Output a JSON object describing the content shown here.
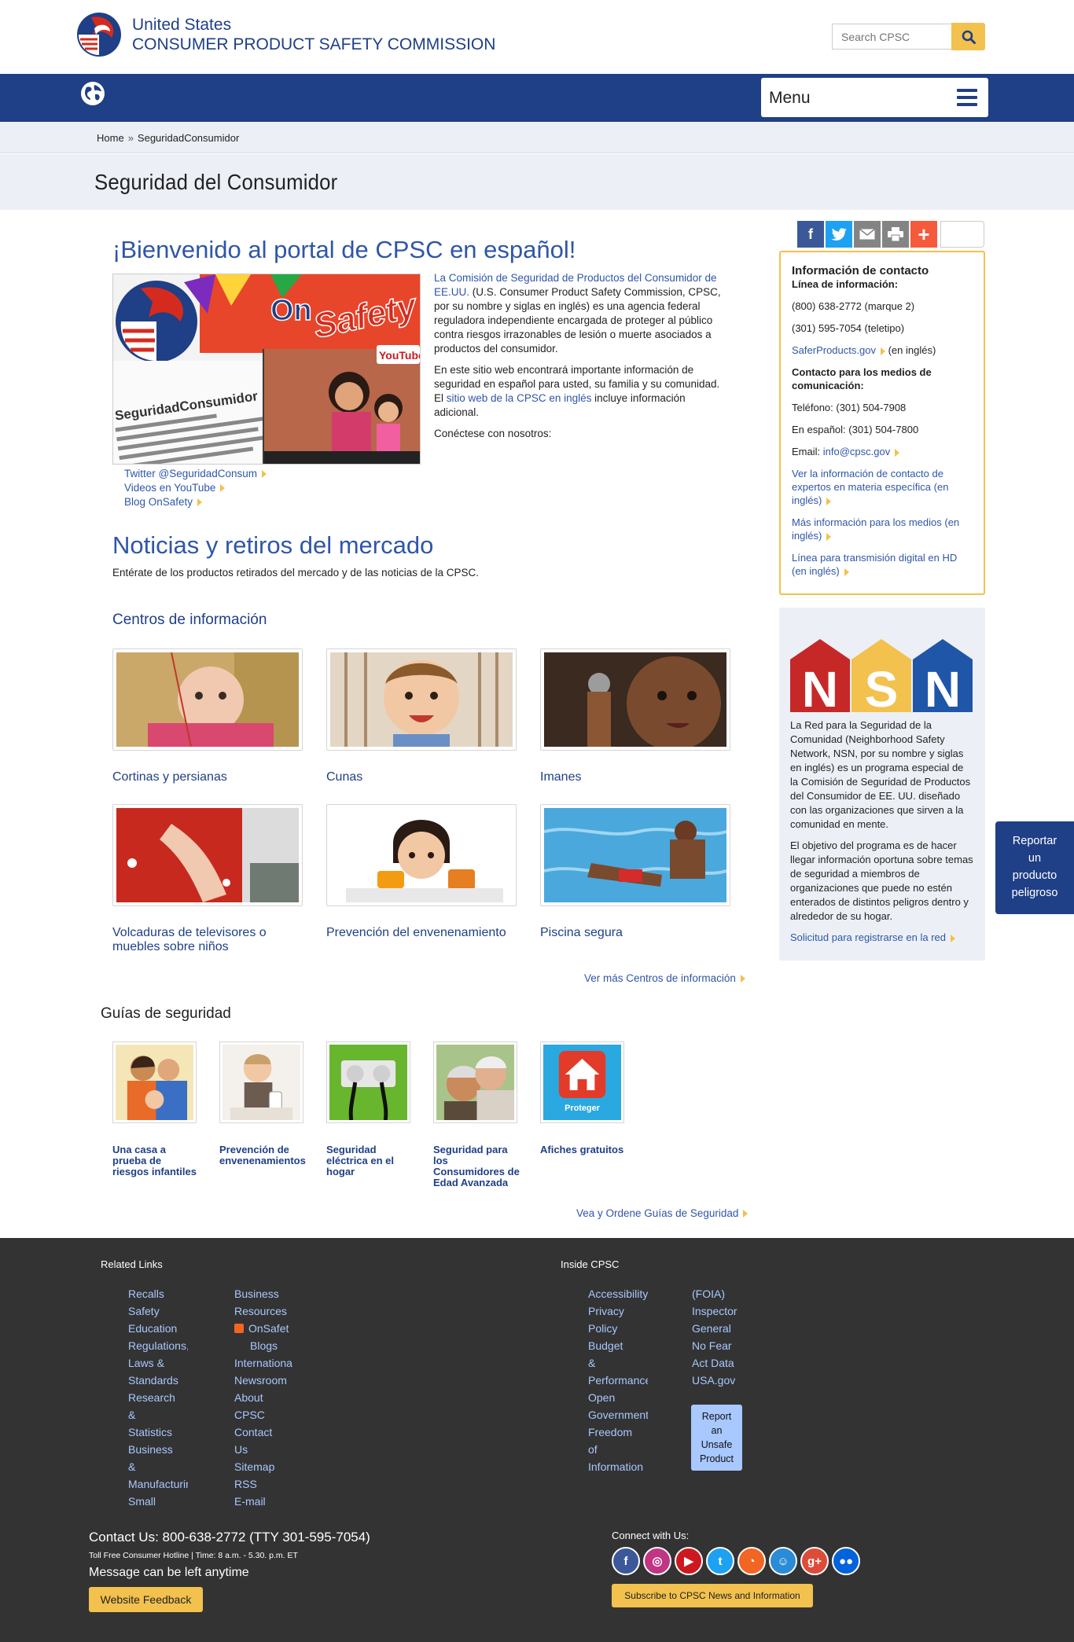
{
  "header": {
    "org_line1": "United States",
    "org_line2": "CONSUMER PRODUCT SAFETY COMMISSION",
    "search_placeholder": "Search CPSC"
  },
  "nav": {
    "menu_label": "Menu"
  },
  "breadcrumb": {
    "home": "Home",
    "sep": "»",
    "current": "SeguridadConsumidor"
  },
  "page_title": "Seguridad del Consumidor",
  "share": {
    "count": ""
  },
  "welcome": {
    "heading": "¡Bienvenido al portal de CPSC en español!",
    "para1_link": "La Comisión de Seguridad de Productos del Consumidor de EE.UU.",
    "para1_rest": " (U.S. Consumer Product Safety Commission, CPSC, por su nombre y siglas en inglés) es una agencia federal reguladora independiente encargada de proteger al público contra riesgos irrazonables de lesión o muerte asociados a productos del consumidor.",
    "para2_start": "En este sitio web encontrará importante información de seguridad en español para usted, su familia y su comunidad. El ",
    "para2_link": "sitio web de la CPSC en inglés",
    "para2_end": " incluye información adicional.",
    "para3": "Conéctese con nosotros:",
    "links": [
      "Twitter @SeguridadConsum",
      "Videos en YouTube",
      "Blog OnSafety"
    ],
    "image_text": {
      "on": "On",
      "safety": "Safety",
      "handle": "SeguridadConsumidor",
      "youtube": "YouTube"
    }
  },
  "news": {
    "heading": "Noticias y retiros del mercado",
    "subtitle": "Entérate de los productos retirados del mercado y de las noticias de la CPSC."
  },
  "centros": {
    "heading": "Centros de información",
    "items": [
      "Cortinas y persianas",
      "Cunas",
      "Imanes",
      "Volcaduras de televisores o muebles sobre niños",
      "Prevención del envenenamiento",
      "Piscina segura"
    ],
    "more": "Ver más Centros de información"
  },
  "guias": {
    "heading": "Guías de seguridad",
    "items": [
      "Una casa a prueba de riesgos infantiles",
      "Prevención de envenenamientos",
      "Seguridad eléctrica en el hogar",
      "Seguridad para los Consumidores de Edad Avanzada",
      "Afiches gratuitos"
    ],
    "poster_label": "Proteger",
    "more": "Vea y Ordene Guías de Seguridad"
  },
  "contact": {
    "heading": "Información de contacto",
    "line_heading": "Línea de información:",
    "phone1": "(800) 638-2772 (marque 2)",
    "phone2": "(301) 595-7054 (teletipo)",
    "saferproducts": "SaferProducts.gov",
    "saferproducts_note": "(en inglés)",
    "media_heading": "Contacto para los medios de comunicación:",
    "tel": "Teléfono: (301) 504-7908",
    "spanish": "En español: (301) 504-7800",
    "email_label": "Email: ",
    "email": "info@cpsc.gov",
    "link1": "Ver la información de contacto de expertos en materia específica (en inglés)",
    "link2": "Más información para los medios (en inglés)",
    "link3": "Línea para transmisión digital en HD (en inglés)"
  },
  "nsn": {
    "logo_letters": [
      "N",
      "S",
      "N"
    ],
    "para1": "La Red para la Seguridad de la Comunidad (Neighborhood Safety Network, NSN, por su nombre y siglas en inglés) es un programa especial de la Comisión de Seguridad de Productos del Consumidor de EE. UU. diseñado con las organizaciones que sirven a la comunidad en mente.",
    "para2": "El objetivo del programa es de hacer llegar información oportuna sobre temas de seguridad a miembros de organizaciones que puede no estén enterados de distintos peligros dentro y alrededor de su hogar.",
    "link": "Solicitud para registrarse en la red"
  },
  "report_tab": [
    "Reportar",
    "un",
    "producto",
    "peligroso"
  ],
  "footer": {
    "related_heading": "Related Links",
    "inside_heading": "Inside CPSC",
    "related_col1": [
      "Recalls",
      "Safety",
      "Education",
      "Regulations,",
      "Laws &",
      "Standards",
      "Research",
      "&",
      "Statistics",
      "Business",
      "&",
      "Manufacturir",
      "Small"
    ],
    "related_col2": [
      "Business",
      "Resources",
      "OnSafet",
      "Blogs",
      "Internationa",
      "Newsroom",
      "About",
      "CPSC",
      "Contact",
      "Us",
      "Sitemap",
      "RSS",
      "E-mail"
    ],
    "inside_col1": [
      "Accessibility",
      "Privacy",
      "Policy",
      "Budget",
      "&",
      "Performance",
      "Open",
      "Government",
      "Freedom",
      "of",
      "Information"
    ],
    "inside_col2": [
      "(FOIA)",
      "Inspector",
      "General",
      "No Fear",
      "Act Data",
      "USA.gov"
    ],
    "report_btn": [
      "Report",
      "an",
      "Unsafe",
      "Product"
    ],
    "contact_us": "Contact Us: 800-638-2772 (TTY 301-595-7054)",
    "hotline": "Toll Free Consumer Hotline | Time: 8 a.m. - 5.30. p.m. ET",
    "message": "Message can be left anytime",
    "feedback_btn": "Website Feedback",
    "connect": "Connect with Us:",
    "subscribe_btn": "Subscribe to CPSC News and Information",
    "social": [
      {
        "name": "facebook-icon",
        "glyph": "f",
        "color": "#3b5998"
      },
      {
        "name": "instagram-icon",
        "glyph": "◎",
        "color": "#c13584"
      },
      {
        "name": "youtube-icon",
        "glyph": "▶",
        "color": "#cc181e"
      },
      {
        "name": "twitter-icon",
        "glyph": "t",
        "color": "#1da1f2"
      },
      {
        "name": "rss-icon",
        "glyph": "◔",
        "color": "#f26522"
      },
      {
        "name": "flickr-podcast-icon",
        "glyph": "☺",
        "color": "#2a8bd6"
      },
      {
        "name": "google-plus-icon",
        "glyph": "g+",
        "color": "#dd4b39"
      },
      {
        "name": "flickr-icon",
        "glyph": "●●",
        "color": "#0063dc"
      }
    ]
  }
}
